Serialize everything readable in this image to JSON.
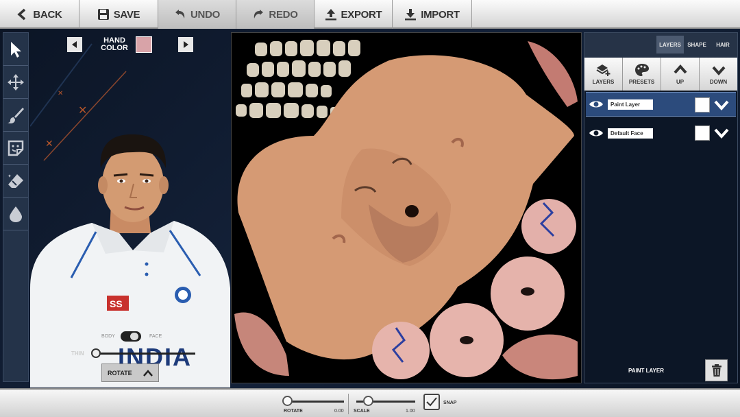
{
  "toolbar": {
    "back": "BACK",
    "save": "SAVE",
    "undo": "UNDO",
    "redo": "REDO",
    "export": "EXPORT",
    "import": "IMPORT"
  },
  "tools": [
    "select-arrow-icon",
    "move-icon",
    "brush-icon",
    "sticker-icon",
    "eraser-icon",
    "drop-icon"
  ],
  "hand_color": {
    "label_line1": "HAND",
    "label_line2": "COLOR",
    "swatch": "#d8a3a8"
  },
  "player": {
    "shirt_logo": "SS",
    "shirt_text": "INDIA",
    "toggle_left": "BODY",
    "toggle_right": "FACE",
    "slider_label": "THIN",
    "rotate_label": "ROTATE"
  },
  "panel": {
    "tabs": [
      {
        "label": "LAYERS",
        "active": true
      },
      {
        "label": "SHAPE",
        "active": false
      },
      {
        "label": "HAIR",
        "active": false
      }
    ],
    "actions": [
      {
        "label": "LAYERS",
        "icon": "layers-add-icon"
      },
      {
        "label": "PRESETS",
        "icon": "palette-icon"
      },
      {
        "label": "UP",
        "icon": "chevron-up-icon"
      },
      {
        "label": "DOWN",
        "icon": "chevron-down-icon"
      }
    ],
    "layers": [
      {
        "name": "Paint Layer",
        "selected": true
      },
      {
        "name": "Default Face",
        "selected": false
      }
    ],
    "current_layer": "PAINT LAYER"
  },
  "bottom": {
    "rotate_label": "ROTATE",
    "rotate_value": "0.00",
    "scale_label": "SCALE",
    "scale_value": "1.00",
    "snap_label": "SNAP"
  },
  "colors": {
    "accent": "#2c4b7c",
    "skin": "#d9a07d"
  }
}
